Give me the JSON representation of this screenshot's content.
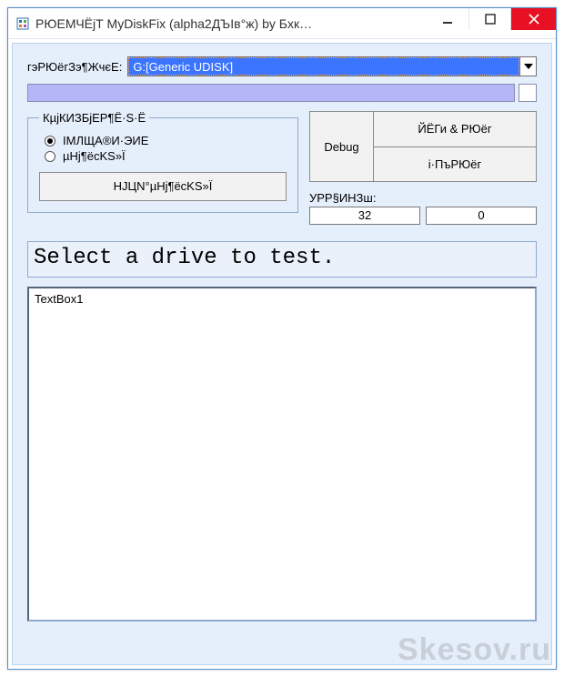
{
  "window": {
    "title": "РЮЕМЧЁјТ MyDiskFix (alpha2ДЪІв°ж) by Бхк…"
  },
  "drive": {
    "label": "гэРЮёгЗэ¶ЖчєЕ:",
    "selected": "G:[Generic UDISK]"
  },
  "group": {
    "legend": "КµјКИЗБјЕР¶Ё·S·Ё",
    "opt1": "ІМЛЩА®И·ЭИЕ",
    "opt2": "µНј¶ёcKS»Ї",
    "button": "НЈЦN°µНј¶ёcKS»Ї"
  },
  "right": {
    "debug": "Debug",
    "btn1": "ЙЁГи & РЮёг",
    "btn2": "і·ПъРЮёг",
    "urrLabel": "УРР§ИНЗш:",
    "val1": "32",
    "val2": "0"
  },
  "status": "Select a drive to test.",
  "log": "TextBox1",
  "watermark": "Skesov.ru"
}
